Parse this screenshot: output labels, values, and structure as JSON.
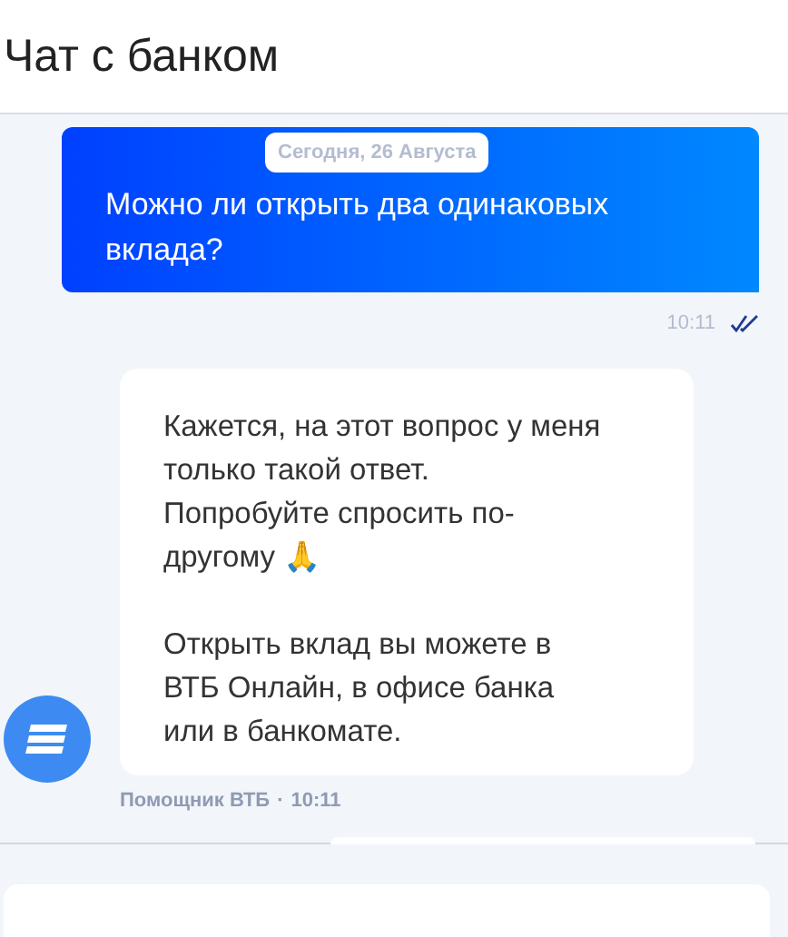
{
  "header": {
    "title": "Чат с банком"
  },
  "date_chip": "Сегодня, 26 Августа",
  "messages": [
    {
      "kind": "user",
      "text": "Можно ли открыть два одинаковых вклада?",
      "time": "10:11",
      "read": true
    },
    {
      "kind": "bot",
      "paragraphs": [
        "Кажется, на этот вопрос у меня только такой ответ. Попробуйте спросить по-другому 🙏",
        "Открыть вклад вы можете в ВТБ Онлайн, в офисе банка или в банкомате."
      ],
      "sender": "Помощник ВТБ",
      "separator": "·",
      "time": "10:11"
    }
  ]
}
